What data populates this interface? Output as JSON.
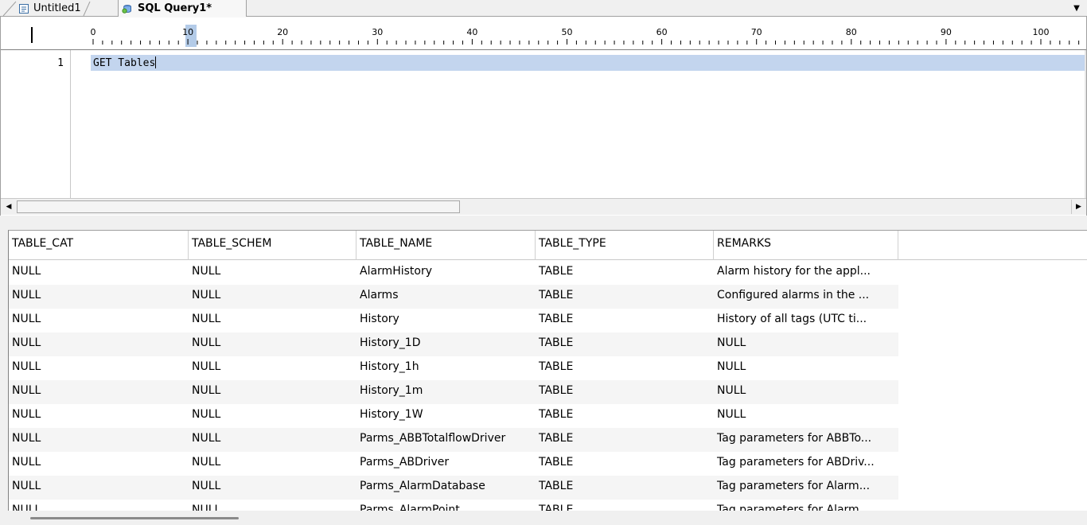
{
  "tabs": [
    {
      "label": "Untitled1",
      "icon": "document-icon",
      "active": false
    },
    {
      "label": "SQL Query1*",
      "icon": "sql-query-icon",
      "active": true
    }
  ],
  "ruler": {
    "labels": [
      "0",
      "10",
      "20",
      "30",
      "40",
      "50",
      "60",
      "70",
      "80",
      "90",
      "100"
    ]
  },
  "editor": {
    "lines": [
      {
        "number": "1",
        "text": "GET Tables"
      }
    ]
  },
  "results": {
    "columns": [
      "TABLE_CAT",
      "TABLE_SCHEM",
      "TABLE_NAME",
      "TABLE_TYPE",
      "REMARKS"
    ],
    "rows": [
      [
        "NULL",
        "NULL",
        "AlarmHistory",
        "TABLE",
        "Alarm history for the appl..."
      ],
      [
        "NULL",
        "NULL",
        "Alarms",
        "TABLE",
        "Configured alarms in the ..."
      ],
      [
        "NULL",
        "NULL",
        "History",
        "TABLE",
        "History of all tags (UTC ti..."
      ],
      [
        "NULL",
        "NULL",
        "History_1D",
        "TABLE",
        "NULL"
      ],
      [
        "NULL",
        "NULL",
        "History_1h",
        "TABLE",
        "NULL"
      ],
      [
        "NULL",
        "NULL",
        "History_1m",
        "TABLE",
        "NULL"
      ],
      [
        "NULL",
        "NULL",
        "History_1W",
        "TABLE",
        "NULL"
      ],
      [
        "NULL",
        "NULL",
        "Parms_ABBTotalflowDriver",
        "TABLE",
        "Tag parameters for ABBTo..."
      ],
      [
        "NULL",
        "NULL",
        "Parms_ABDriver",
        "TABLE",
        "Tag parameters for ABDriv..."
      ],
      [
        "NULL",
        "NULL",
        "Parms_AlarmDatabase",
        "TABLE",
        "Tag parameters for Alarm..."
      ],
      [
        "NULL",
        "NULL",
        "Parms_AlarmPoint",
        "TABLE",
        "Tag parameters for Alarm..."
      ]
    ]
  },
  "colors": {
    "selection": "#c3d5ee",
    "ruler_highlight": "#b3cbe8",
    "chrome": "#f0f0f0"
  }
}
